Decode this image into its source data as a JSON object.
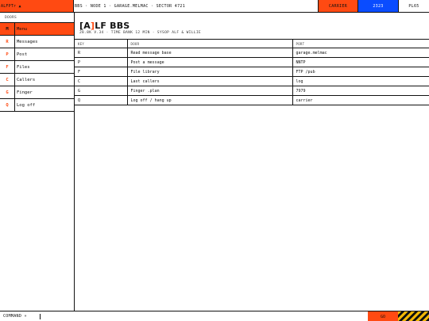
{
  "topbar": {
    "brand": "ALFPTr ▲",
    "crumb": "BBS · NODE 1 · GARAGE.MELMAC · SECTOR 4721",
    "carrier_label": "CARRIER",
    "baud_label": "2323",
    "plus_label": "PL65"
  },
  "sidebar": {
    "header": "DOORS",
    "items": [
      {
        "key": "M",
        "label": "Menu",
        "active": true
      },
      {
        "key": "R",
        "label": "Messages"
      },
      {
        "key": "P",
        "label": "Post"
      },
      {
        "key": "F",
        "label": "Files"
      },
      {
        "key": "C",
        "label": "Callers"
      },
      {
        "key": "G",
        "label": "Finger"
      },
      {
        "key": "Q",
        "label": "Log off"
      }
    ]
  },
  "main": {
    "title_open": "[A",
    "title_bracket": "]",
    "title_rest": "LF BBS",
    "subtitle": "28.8K V.34 · TIME BANK 12 MIN · SYSOP ALF & WILLIE",
    "table": {
      "headers": [
        "KEY",
        "DOOR",
        "PORT"
      ],
      "rows": [
        [
          "R",
          "Read message base",
          "garage.melmac"
        ],
        [
          "P",
          "Post a message",
          "NNTP"
        ],
        [
          "F",
          "File library",
          "FTP /pub"
        ],
        [
          "C",
          "Last callers",
          "log"
        ],
        [
          "G",
          "Finger .plan",
          "7979"
        ],
        [
          "Q",
          "Log off / hang up",
          "carrier"
        ]
      ]
    }
  },
  "bottombar": {
    "command_label": "COMMAND »",
    "go_label": "GO"
  },
  "colors": {
    "accent": "#ff4a12",
    "baud_blue": "#0a4cff",
    "hazard_yellow": "#f2b705"
  }
}
